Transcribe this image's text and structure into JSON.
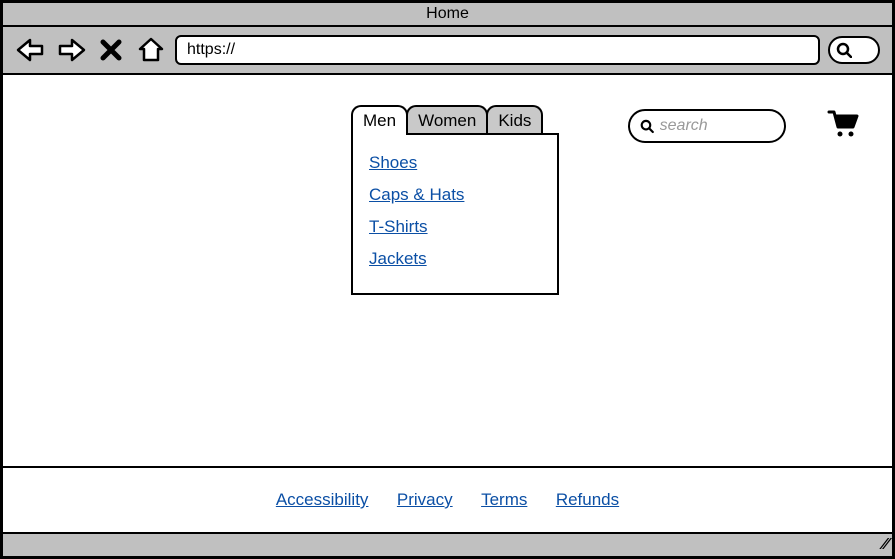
{
  "window": {
    "title": "Home"
  },
  "browser": {
    "url": "https://"
  },
  "nav": {
    "tabs": [
      {
        "label": "Men",
        "active": true
      },
      {
        "label": "Women",
        "active": false
      },
      {
        "label": "Kids",
        "active": false
      }
    ],
    "menu_items": [
      "Shoes",
      "Caps & Hats",
      "T-Shirts",
      "Jackets"
    ]
  },
  "search": {
    "placeholder": "search"
  },
  "footer": {
    "links": [
      "Accessibility",
      "Privacy",
      "Terms",
      "Refunds"
    ]
  }
}
